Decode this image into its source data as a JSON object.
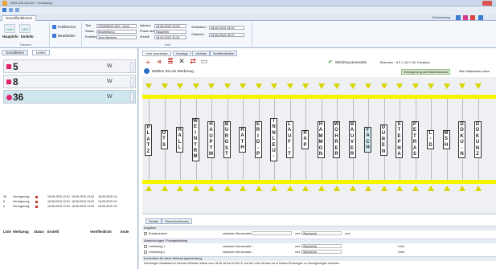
{
  "window": {
    "title": "CDIS-ZW-08-001 * Umleitung"
  },
  "ribbon": {
    "tab_label": "Grundfunktionen",
    "btn_open": "Umb",
    "btn_new": "DEO",
    "btn_main": "Hauptinfo",
    "btn_end": "Endinfo",
    "btn_publish": "Publizieren",
    "btn_edit": "Bearbeiten",
    "group_caption_1": "Themen",
    "group_caption_2": "Info",
    "field_labels": [
      "Titel",
      "Status",
      "Ersteller"
    ],
    "field_values": [
      "CDIS09619-001 * Ums...",
      "Bearbeitung",
      "Jens Mertens"
    ],
    "date_labels": [
      "Aktiviert",
      "Phase aktiv",
      "Erstellt"
    ],
    "date_values": [
      "18.06.2015 13:00",
      "Hauptinfo",
      "18.06.2015 12:51"
    ],
    "right_labels": [
      "Startdatum",
      "Geändert"
    ],
    "right_values": [
      "18.06.2015 15:00",
      "19.06.2015 15:37"
    ],
    "status_text": "Betriebsweg"
  },
  "left": {
    "tabs": [
      "Grundlinien",
      "Linien"
    ],
    "lines": [
      {
        "num": "5",
        "shape": "square",
        "sub": "W"
      },
      {
        "num": "8",
        "shape": "square",
        "sub": "W"
      },
      {
        "num": "36",
        "shape": "dot",
        "sub": "W"
      }
    ],
    "table_headers": [
      "Linie",
      "Werkzeug",
      "Status",
      "Erstellt",
      "Veröffentlicht",
      "Ende"
    ],
    "rows": [
      [
        "36",
        "Verzögerung",
        "18.06.2015 12:51",
        "18.06.2015 13:00",
        "18.06.2015 13:"
      ],
      [
        "8",
        "Verzögerung",
        "18.06.2015 12:51",
        "18.06.2015 13:00",
        "18.06.2015 13:"
      ],
      [
        "5",
        "Verzögerung",
        "18.06.2015 12:51",
        "18.06.2015 13:00",
        "18.06.2015 13:"
      ]
    ]
  },
  "right": {
    "tabs": [
      "Linie bearbeiten",
      "Verzüge",
      "Verlinke",
      "Veröffentlichen"
    ],
    "hint": "Wählen Sie ein Werkzeug",
    "apply": "Werkzeug anwenden",
    "apply_right": "Beenden  ·  8 E L 16 V 36. Fahrplan",
    "mode_active": "Verzögerung auf Abfahrtsweise",
    "mode_other": "Alle Haltestellen wiss.",
    "stops": [
      {
        "name": "PLATZ",
        "sel": false
      },
      {
        "name": "OTS",
        "sel": false
      },
      {
        "name": "HALL",
        "sel": false
      },
      {
        "name": "WEINTRM",
        "sel": false
      },
      {
        "name": "HAUPTM",
        "sel": false
      },
      {
        "name": "BURGST",
        "sel": false
      },
      {
        "name": "RATH",
        "sel": false
      },
      {
        "name": "ERID-P",
        "sel": false
      },
      {
        "name": "INNLEU-",
        "sel": false
      },
      {
        "name": "LAUF-T",
        "sel": false
      },
      {
        "name": "RAP",
        "sel": false
      },
      {
        "name": "HAMMON",
        "sel": false
      },
      {
        "name": "WOHRER",
        "sel": false
      },
      {
        "name": "BAUVER",
        "sel": false
      },
      {
        "name": "FACH",
        "sel": true
      },
      {
        "name": "DUREN",
        "sel": false
      },
      {
        "name": "STEPNA",
        "sel": false
      },
      {
        "name": "PETRAS",
        "sel": false
      },
      {
        "name": "L-D",
        "sel": false
      },
      {
        "name": "MSH",
        "sel": false
      },
      {
        "name": "DOKU-N",
        "sel": false
      },
      {
        "name": "DOKUNZ",
        "sel": false
      }
    ],
    "detail_tabs": [
      "Details",
      "Steuerfunktionen"
    ],
    "group1": "Angaben",
    "row1_label": "Ersatzverkehr",
    "row1_mid": "zwischen  Neuenrade...",
    "row1_und": "und",
    "row1_end": "Stephansk...",
    "row1_bis": "und",
    "group2": "Abweichungen / Fahrgastleitung",
    "row2_label": "Umleitung 1",
    "row3_label": "Umleitung 2",
    "row_mid": "zwischen  Neuenrade...",
    "row_und": "und",
    "row_end": "Stephansk...",
    "row_linie": "Linie",
    "group3": "Kontrolltext für diese Werkzeuganwendung",
    "control_text": "Nürnberger Stadtbahn im Bereich Wöhrder Wiese vom 18.06.15 bis 20.06.15. Auf der Linie 36 kann es in beiden Richtungen zu Verzögerungen kommen."
  }
}
